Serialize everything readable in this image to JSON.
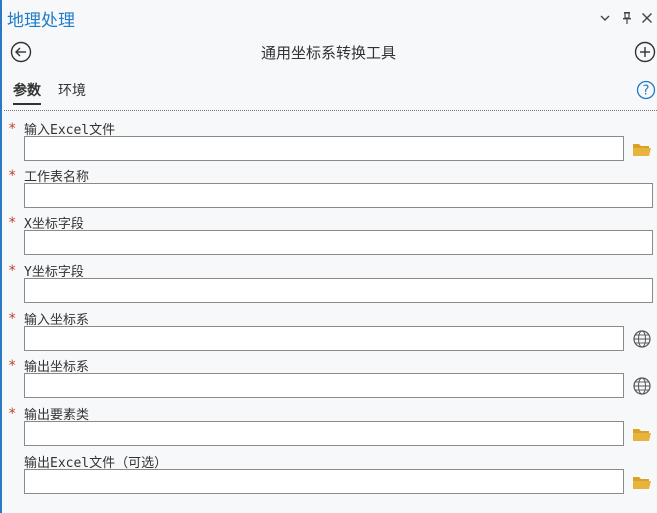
{
  "window": {
    "title": "地理处理",
    "controls": [
      "⌄",
      "ᵖ",
      "✕"
    ]
  },
  "tool": {
    "title": "通用坐标系转换工具"
  },
  "tabs": [
    {
      "label": "参数",
      "active": true
    },
    {
      "label": "环境",
      "active": false
    }
  ],
  "params": [
    {
      "label": "输入Excel文件",
      "required": "*",
      "value": "",
      "icon": "folder-icon"
    },
    {
      "label": "工作表名称",
      "required": "*",
      "value": "",
      "icon": ""
    },
    {
      "label": "X坐标字段",
      "required": "*",
      "value": "",
      "icon": ""
    },
    {
      "label": "Y坐标字段",
      "required": "*",
      "value": "",
      "icon": ""
    },
    {
      "label": "输入坐标系",
      "required": "*",
      "value": "",
      "icon": "globe-icon"
    },
    {
      "label": "输出坐标系",
      "required": "*",
      "value": "",
      "icon": "globe-icon"
    },
    {
      "label": "输出要素类",
      "required": "*",
      "value": "",
      "icon": "folder-icon"
    },
    {
      "label": "输出Excel文件（可选）",
      "required": "",
      "value": "",
      "icon": "folder-icon"
    }
  ],
  "colors": {
    "accent": "#1f7cc8",
    "required": "#c53a2a",
    "folder": "#e6b43c"
  }
}
